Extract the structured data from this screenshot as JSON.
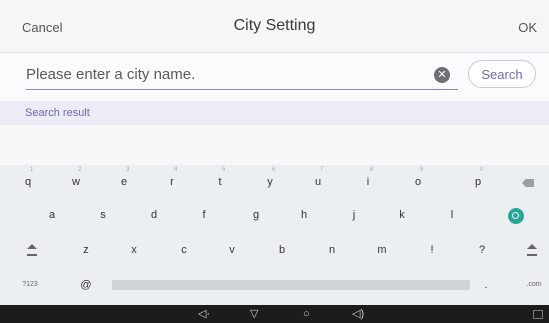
{
  "header": {
    "cancel_label": "Cancel",
    "title": "City Setting",
    "ok_label": "OK"
  },
  "search": {
    "placeholder": "Please enter a city name.",
    "value": "",
    "clear_icon": "clear-icon",
    "button_label": "Search"
  },
  "results": {
    "label": "Search result"
  },
  "keyboard": {
    "row1": [
      {
        "key": "q",
        "hint": "1"
      },
      {
        "key": "w",
        "hint": "2"
      },
      {
        "key": "e",
        "hint": "3"
      },
      {
        "key": "r",
        "hint": "4"
      },
      {
        "key": "t",
        "hint": "5"
      },
      {
        "key": "y",
        "hint": "6"
      },
      {
        "key": "u",
        "hint": "7"
      },
      {
        "key": "i",
        "hint": "8"
      },
      {
        "key": "o",
        "hint": "9"
      },
      {
        "key": "p",
        "hint": "0"
      }
    ],
    "row2": [
      "a",
      "s",
      "d",
      "f",
      "g",
      "h",
      "j",
      "k",
      "l"
    ],
    "row3": [
      "z",
      "x",
      "c",
      "v",
      "b",
      "n",
      "m",
      "!",
      "?"
    ],
    "row4": {
      "symbols": "?123",
      "at": "@",
      "period": ".",
      "com": ".com"
    },
    "icons": {
      "backspace": "backspace-icon",
      "search": "search-icon",
      "shift": "shift-icon"
    }
  },
  "navbar": {
    "icons": [
      "volume-down-icon",
      "back-icon",
      "home-icon",
      "volume-up-icon",
      "recents-icon"
    ]
  },
  "colors": {
    "accent": "#6a6ab0",
    "search_key": "#26a69a",
    "navbar": "#1c1c1c"
  }
}
